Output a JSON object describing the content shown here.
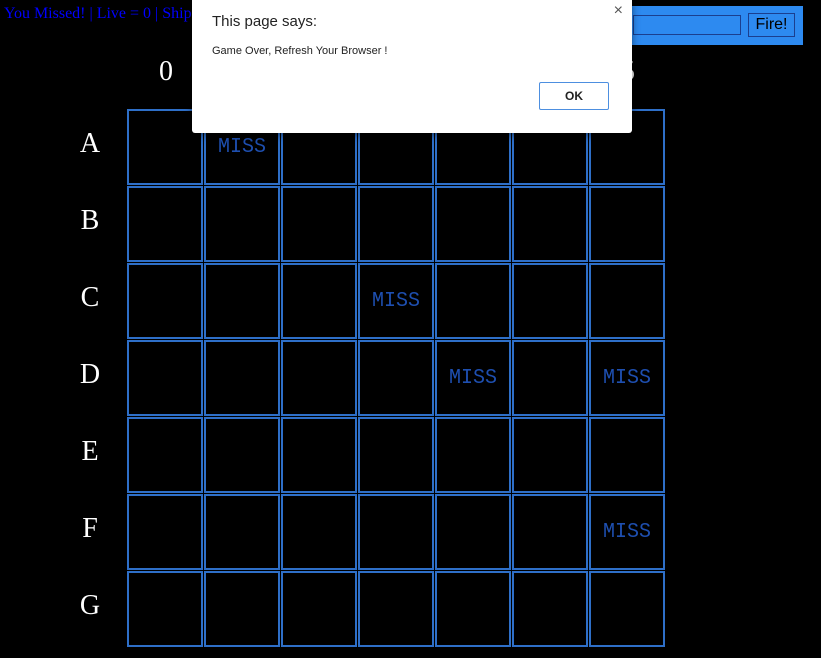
{
  "status_text": "You Missed! | Live = 0 | Ship",
  "fire_panel": {
    "input_value": "",
    "fire_label": "Fire!"
  },
  "columns": [
    "0",
    "",
    "",
    "",
    "",
    "",
    "5"
  ],
  "rows": [
    "A",
    "B",
    "C",
    "D",
    "E",
    "F",
    "G"
  ],
  "miss_label": "MISS",
  "misses": [
    [
      0,
      1
    ],
    [
      2,
      3
    ],
    [
      3,
      4
    ],
    [
      3,
      6
    ],
    [
      5,
      6
    ]
  ],
  "dialog": {
    "title": "This page says:",
    "message": "Game Over, Refresh Your Browser !",
    "ok_label": "OK",
    "close_glyph": "×"
  },
  "colors": {
    "grid": "#2e6fc8",
    "miss": "#1e4fb0",
    "panel": "#2d8af0",
    "status": "#0000ff"
  }
}
